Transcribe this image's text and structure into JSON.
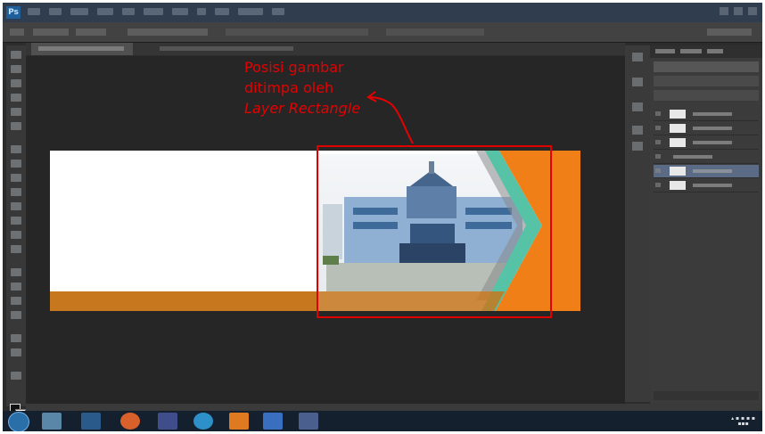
{
  "app": {
    "name": "Photoshop",
    "logo_text": "Ps"
  },
  "annotation": {
    "line1": "Posisi gambar",
    "line2": "ditimpa oleh",
    "line3": "Layer Rectangle",
    "color": "#e60000"
  },
  "colors": {
    "workspace_bg": "#2c2c2c",
    "menubar_bg": "#2f3d4e",
    "banner_orange": "#f07f18",
    "banner_bar": "#c7781f",
    "banner_teal": "#56c3a6",
    "highlight_red": "#e00000",
    "taskbar_bg": "#14202e"
  },
  "icons": {
    "toolbox": "tool-icons",
    "start": "windows-start-icon",
    "taskbar": [
      "explorer-icon",
      "media-player-icon",
      "firefox-icon",
      "email-icon",
      "chrome-icon",
      "photoshop-icon",
      "video-icon",
      "screenshot-icon"
    ]
  }
}
